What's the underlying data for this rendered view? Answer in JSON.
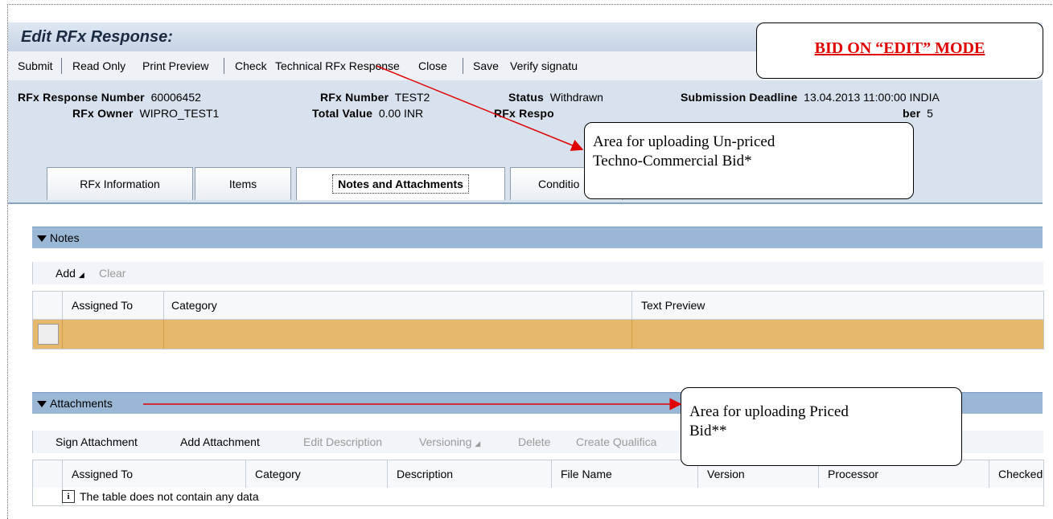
{
  "window": {
    "title": "Edit RFx Response:"
  },
  "toolbar": {
    "submit": "Submit",
    "read_only": "Read Only",
    "print_preview": "Print Preview",
    "check": "Check",
    "technical_rfx_response": "Technical RFx Response",
    "close": "Close",
    "save": "Save",
    "verify_signature": "Verify signatu"
  },
  "header": {
    "rfx_response_number_label": "RFx Response Number",
    "rfx_response_number": "60006452",
    "rfx_number_label": "RFx Number",
    "rfx_number": "TEST2",
    "status_label": "Status",
    "status": "Withdrawn",
    "submission_deadline_label": "Submission Deadline",
    "submission_deadline": "13.04.2013 11:00:00 INDIA",
    "rfx_owner_label": "RFx Owner",
    "rfx_owner": "WIPRO_TEST1",
    "total_value_label": "Total Value",
    "total_value": "0.00 INR",
    "rfx_response_version_label": "RFx Respo",
    "version_number_label": "ber",
    "version_number": "5"
  },
  "tabs": [
    "RFx Information",
    "Items",
    "Notes and Attachments",
    "Conditio"
  ],
  "notes": {
    "section_title": "Notes",
    "add_label": "Add",
    "clear_label": "Clear",
    "columns": [
      "Assigned To",
      "Category",
      "Text Preview"
    ]
  },
  "attachments": {
    "section_title": "Attachments",
    "actions": [
      "Sign Attachment",
      "Add Attachment",
      "Edit Description",
      "Versioning",
      "Delete",
      "Create Qualifica"
    ],
    "columns": [
      "Assigned To",
      "Category",
      "Description",
      "File Name",
      "Version",
      "Processor",
      "Checked"
    ],
    "empty_message": "The table does not contain any data"
  },
  "annotations": {
    "bid_mode": "BID ON “EDIT” MODE",
    "unpriced_line1": "Area for uploading Un-priced",
    "unpriced_line2": "Techno-Commercial Bid*",
    "priced_line1": "Area for uploading Priced",
    "priced_line2": "Bid**"
  },
  "colors": {
    "section_bar": "#9ab7d6",
    "selected_row": "#e5b86b",
    "annotation_red": "#e00000",
    "arrow_red": "#e00000"
  }
}
